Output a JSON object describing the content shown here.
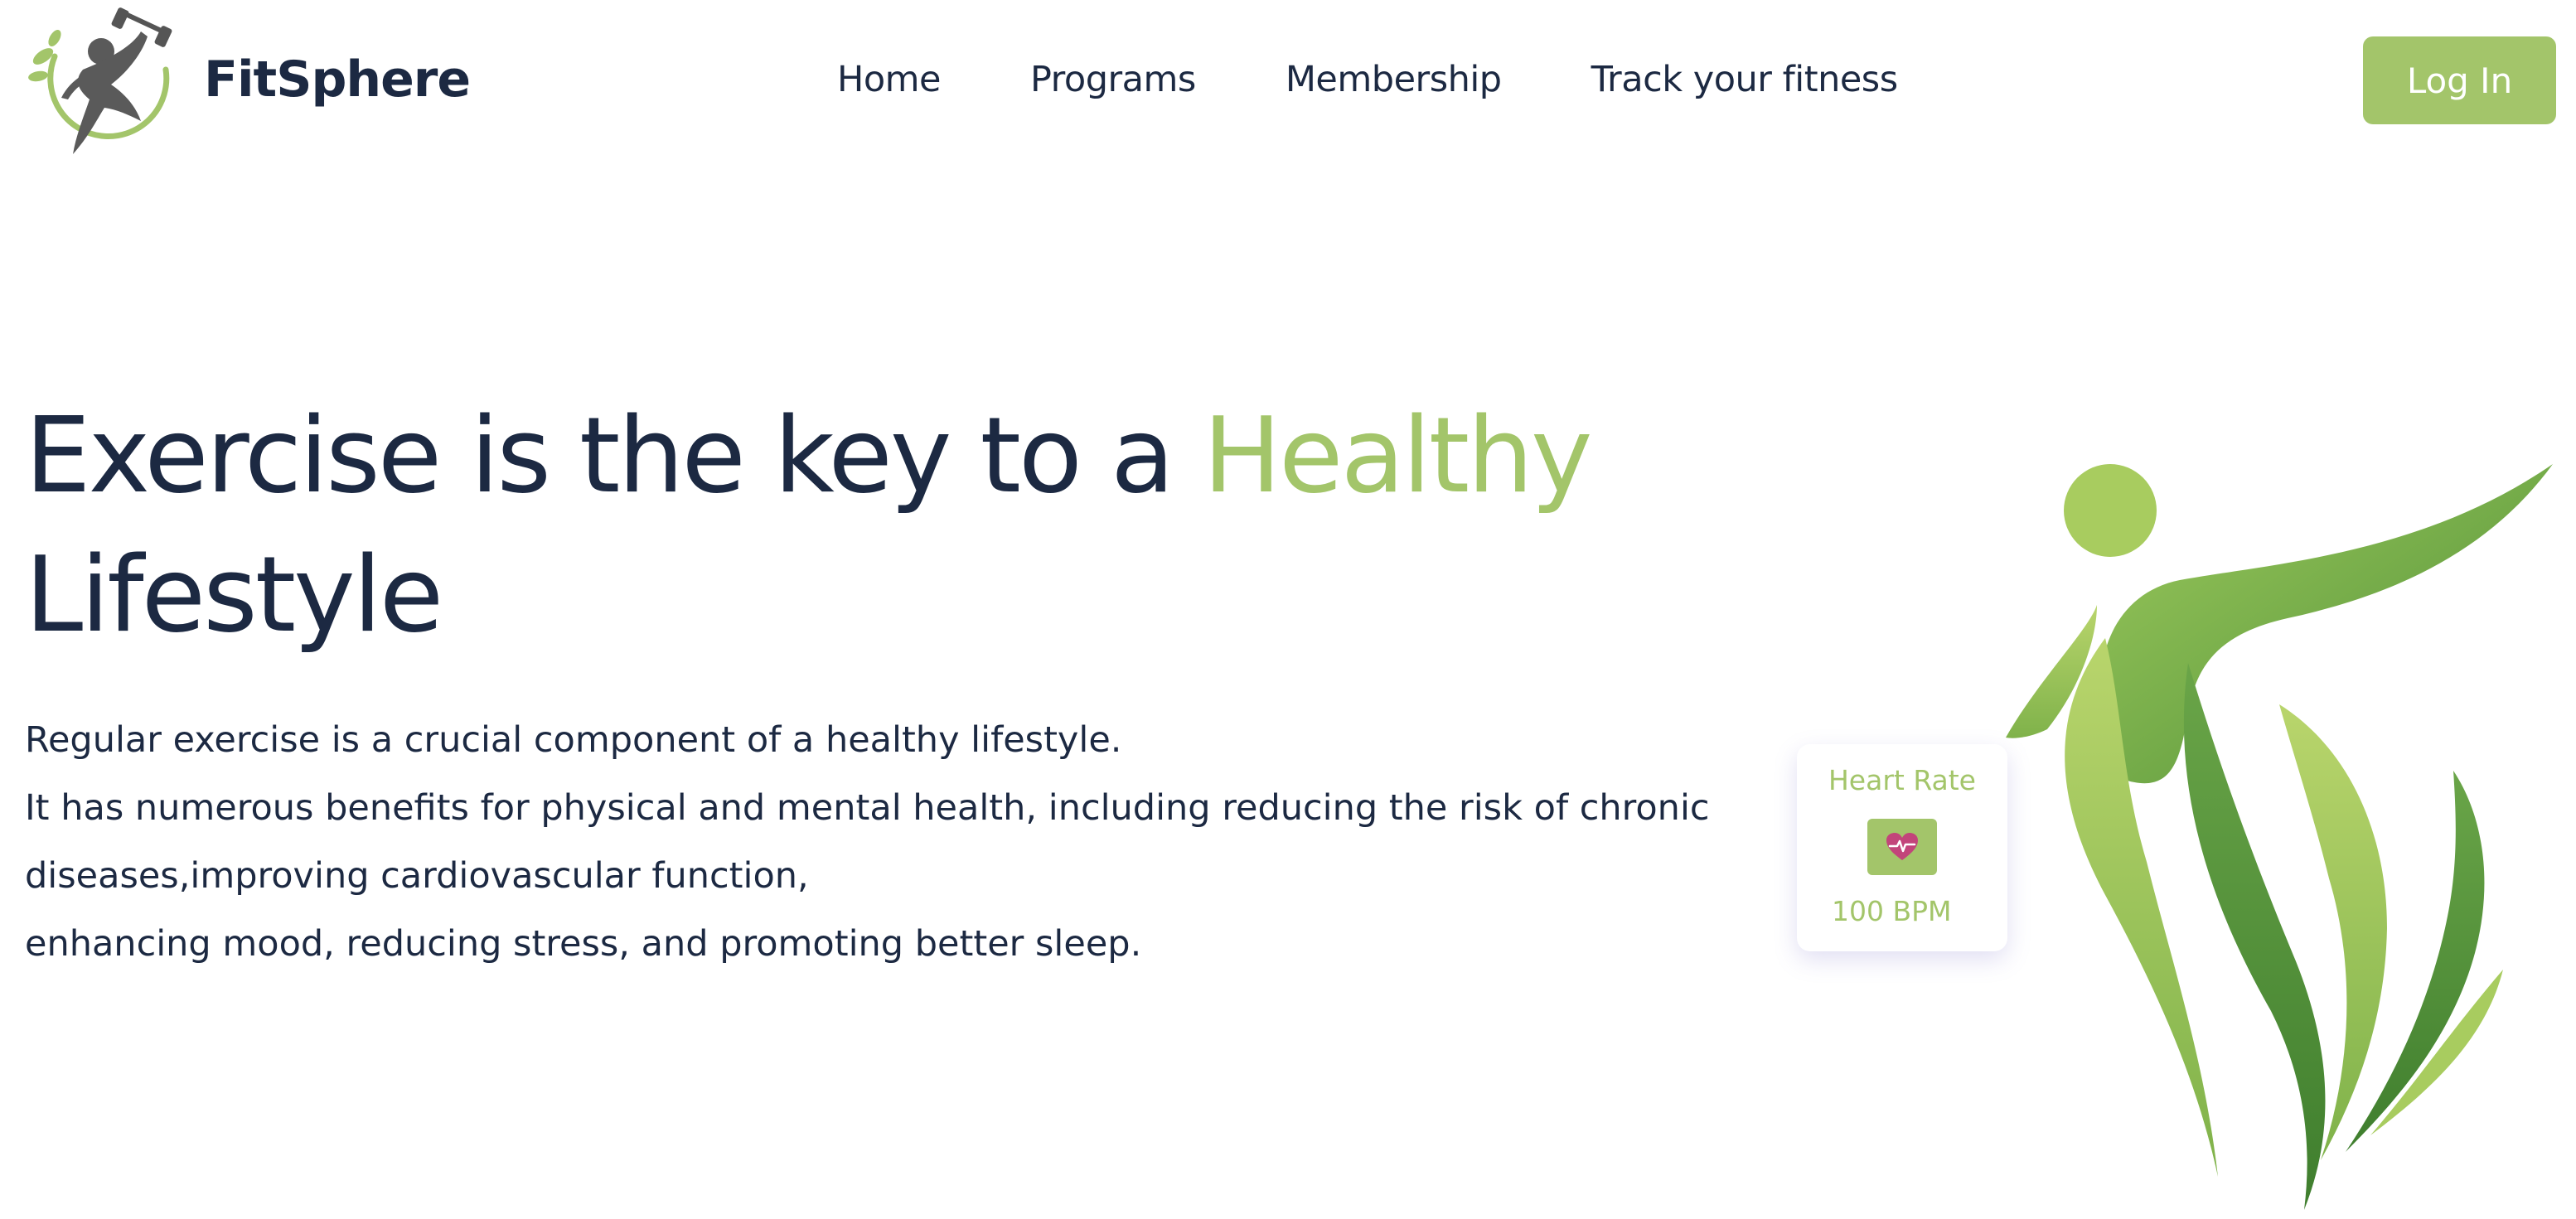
{
  "header": {
    "brand": "FitSphere",
    "logo_icon": "fitness-person-dumbbell-logo",
    "nav": [
      "Home",
      "Programs",
      "Membership",
      "Track your fitness"
    ],
    "login_label": "Log In"
  },
  "hero": {
    "title_main": "Exercise is the key to a ",
    "title_accent": "Healthy",
    "title_end": "Lifestyle",
    "paragraph_lines": [
      "Regular exercise is a crucial component of a healthy lifestyle.",
      "It has numerous benefits for physical and mental health, including reducing the risk of chronic diseases,improving cardiovascular function,",
      "enhancing mood, reducing stress, and promoting better sleep."
    ]
  },
  "heart_card": {
    "title": "Heart Rate",
    "icon": "heart-pulse-icon",
    "value": "100 BPM"
  },
  "colors": {
    "accent": "#a3c56a",
    "text_dark": "#1c2942",
    "heart": "#c2457a",
    "figure_light": "#b5d16a",
    "figure_dark": "#5d9a3e"
  }
}
